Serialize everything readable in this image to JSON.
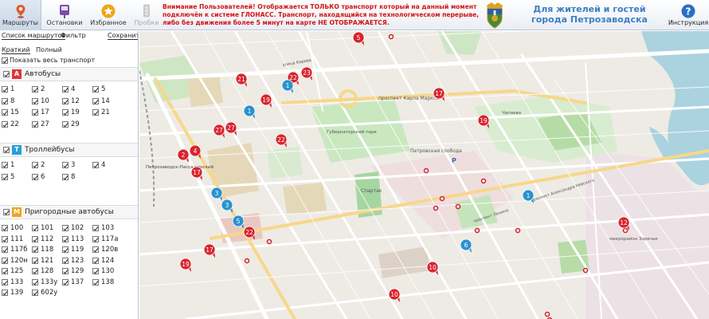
{
  "topbar": {
    "nav": [
      {
        "label": "Маршруты",
        "icon": "pin-icon"
      },
      {
        "label": "Остановки",
        "icon": "bus-stop-icon"
      },
      {
        "label": "Избранное",
        "icon": "star-icon"
      },
      {
        "label": "Пробки",
        "icon": "traffic-light-icon"
      }
    ],
    "notice": "Внимание Пользователей! Отображается ТОЛЬКО транспорт который на данный момент подключён к системе ГЛОНАСС. Транспорт, находящийся на технологическом перерыве, либо без движения более 5 минут на карте НЕ ОТОБРАЖАЕТСЯ.",
    "city_title_line1": "Для жителей и гостей",
    "city_title_line2": "города Петрозаводска",
    "help_label": "Инструкция"
  },
  "sidebar": {
    "tab_list": "Список маршрутов",
    "tab_filter": "Фильтр",
    "save": "Сохранить",
    "mode_short": "Краткий",
    "mode_full": "Полный",
    "show_all": "Показать весь транспорт",
    "groups": [
      {
        "badge": "А",
        "name": "Автобусы",
        "color": "#e0353b",
        "routes": [
          "1",
          "2",
          "4",
          "5",
          "8",
          "10",
          "12",
          "14",
          "15",
          "17",
          "19",
          "21",
          "22",
          "27",
          "29"
        ]
      },
      {
        "badge": "Т",
        "name": "Троллейбусы",
        "color": "#2a9fd8",
        "routes": [
          "1",
          "2",
          "3",
          "4",
          "5",
          "6",
          "8"
        ]
      },
      {
        "badge": "М",
        "name": "Пригородные автобусы",
        "color": "#f0a21e",
        "routes": [
          "100",
          "101",
          "102",
          "103",
          "111",
          "112",
          "113",
          "117a",
          "117б",
          "118",
          "119",
          "120в",
          "120н",
          "121",
          "123",
          "124",
          "125",
          "128",
          "129",
          "130",
          "133",
          "133у",
          "137",
          "138",
          "139",
          "602у"
        ]
      }
    ]
  },
  "map": {
    "labels": {
      "karl_marx": "проспект Карла Маркса",
      "gubernatorsky": "Губернаторский парк",
      "slobodka": "Петровская слобода",
      "spartak": "Спартак",
      "passenger": "Петрозаводск-Пассажирский",
      "zarechye": "микрорайон Заречье",
      "cheapest": "Чапаева",
      "lenin": "проспект Ленина",
      "aleksandra_nevskogo": "проспект Александра Невского",
      "kirova": "улица Кирова",
      "parking": "P"
    },
    "bus_markers": [
      "5",
      "21",
      "22",
      "23",
      "17",
      "19",
      "22",
      "27",
      "27",
      "4",
      "2",
      "17",
      "19",
      "22",
      "17",
      "17",
      "19",
      "10",
      "10",
      "12"
    ],
    "trolley_markers": [
      "1",
      "1",
      "3",
      "3",
      "5",
      "1",
      "6"
    ]
  }
}
